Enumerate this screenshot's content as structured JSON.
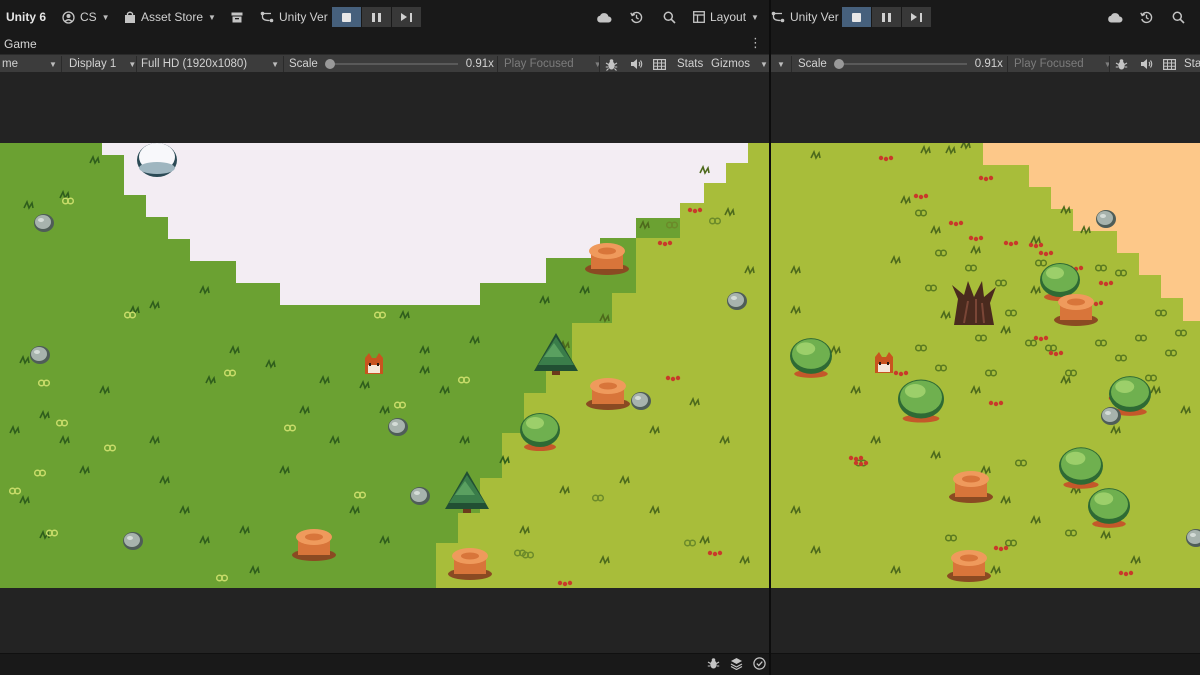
{
  "left": {
    "app_title": "Unity 6",
    "account": "CS",
    "asset_store": "Asset Store",
    "version_control": "Unity Ver",
    "layout": "Layout",
    "tab": "Game",
    "game_bar": {
      "mode": "me",
      "display": "Display 1",
      "resolution": "Full HD (1920x1080)",
      "scale_label": "Scale",
      "scale_value": "0.91x",
      "play_mode": "Play Focused",
      "stats": "Stats",
      "gizmos": "Gizmos"
    }
  },
  "right": {
    "version_control": "Unity Ver",
    "game_bar": {
      "scale_label": "Scale",
      "scale_value": "0.91x",
      "play_mode": "Play Focused",
      "stats": "Sta"
    }
  },
  "icons": {
    "account": "account-icon",
    "store": "bag-icon",
    "archive": "archive-icon",
    "vcs": "branch-icon",
    "cloud": "cloud-icon",
    "history": "history-icon",
    "search": "search-icon",
    "layout": "layout-icon",
    "bug": "bug-icon",
    "audio": "speaker-icon",
    "grid": "grid-icon"
  },
  "colors": {
    "play_active": "#46607c",
    "grass_dark": "#6ba132",
    "grass_light": "#a8bd3a",
    "snow": "#f3edf3",
    "sand": "#fdc889"
  }
}
